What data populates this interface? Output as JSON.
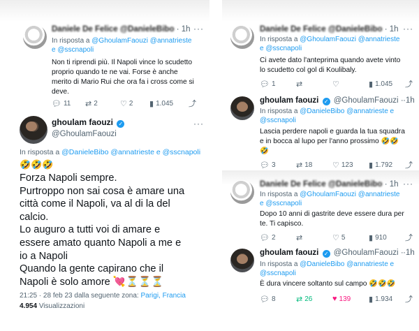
{
  "left_column": {
    "top_tweet": {
      "name": "Daniele De Felice",
      "handle": "@DanieleBibo",
      "time": "1h",
      "reply_prefix": "In risposta a",
      "reply_mentions_line1": "@GhoulamFaouzi @annatrieste",
      "reply_mentions_line2": "e @sscnapoli",
      "text_lines": [
        "Non ti riprendi più. Il Napoli vince lo scudetto",
        "proprio quando te ne vai. Forse è anche",
        "merito di Mario Rui che ora fa i cross come si",
        "deve."
      ],
      "replies": "11",
      "retweets": "2",
      "likes": "2",
      "views": "1.045"
    },
    "main_tweet": {
      "name": "ghoulam faouzi",
      "handle": "@GhoulamFaouzi",
      "reply_prefix": "In risposta a",
      "reply_mentions": "@DanieleBibo @annatrieste e @sscnapoli",
      "emojis": "🤣🤣🤣",
      "text_lines": [
        "Forza Napoli sempre.",
        "Purtroppo non sai cosa è amare una",
        "città come il Napoli, va al di la del",
        "calcio.",
        "Lo auguro a tutti voi di amare e",
        "essere amato quanto Napoli a me e",
        "io a Napoli",
        "Quando la gente capirano che il",
        "Napoli è solo amore 💘⏳⏳⏳"
      ],
      "timestamp": "21:25 · 28 feb 23 dalla seguente zona:",
      "location": "Parigi, Francia",
      "views_count": "4.954",
      "views_label": "Visualizzazioni"
    }
  },
  "right_column": {
    "tweets": [
      {
        "name": "Daniele De Felice",
        "handle": "@DanieleBibo",
        "time": "1h",
        "reply_prefix": "In risposta a",
        "reply_mentions_line1": "@GhoulamFaouzi @annatrieste",
        "reply_mentions_line2": "e @sscnapoli",
        "text_lines": [
          "Ci avete dato l'anteprima quando avete vinto",
          "lo scudetto col gol di Koulibaly."
        ],
        "replies": "1",
        "retweets": "",
        "likes": "",
        "views": "1.045"
      },
      {
        "name": "ghoulam faouzi",
        "handle": "@GhoulamFaouzi",
        "time": "1h",
        "reply_prefix": "In risposta a",
        "reply_mentions_line1": "@DanieleBibo @annatrieste e",
        "reply_mentions_line2": "@sscnapoli",
        "text_lines": [
          "Lascia perdere napoli e guarda la tua squadra",
          "e in bocca al lupo per l'anno prossimo 🤣🤣",
          "🤣"
        ],
        "replies": "3",
        "retweets": "18",
        "likes": "123",
        "views": "1.792"
      },
      {
        "name": "Daniele De Felice",
        "handle": "@DanieleBibo",
        "time": "1h",
        "reply_prefix": "In risposta a",
        "reply_mentions_line1": "@GhoulamFaouzi @annatrieste",
        "reply_mentions_line2": "e @sscnapoli",
        "text_lines": [
          "Dopo 10 anni di gastrite deve essere dura per",
          "te. Ti capisco."
        ],
        "replies": "2",
        "retweets": "",
        "likes": "5",
        "views": "910"
      },
      {
        "name": "ghoulam faouzi",
        "handle": "@GhoulamFaouzi",
        "time": "1h",
        "reply_prefix": "In risposta a",
        "reply_mentions_line1": "@DanieleBibo @annatrieste e",
        "reply_mentions_line2": "@sscnapoli",
        "text_lines": [
          "È dura vincere soltanto sul campo 🤣🤣🤣"
        ],
        "replies": "8",
        "retweets": "26",
        "likes": "139",
        "views": "1.934"
      }
    ]
  },
  "icons": {
    "reply": "reply-icon",
    "retweet": "retweet-icon",
    "like": "heart-icon",
    "views": "views-icon",
    "share": "share-icon",
    "verified": "verified-badge-icon",
    "more": "more-icon"
  },
  "colors": {
    "link": "#1d9bf0",
    "like_active": "#f91880",
    "retweet_active": "#00ba7c",
    "muted": "#536471"
  }
}
